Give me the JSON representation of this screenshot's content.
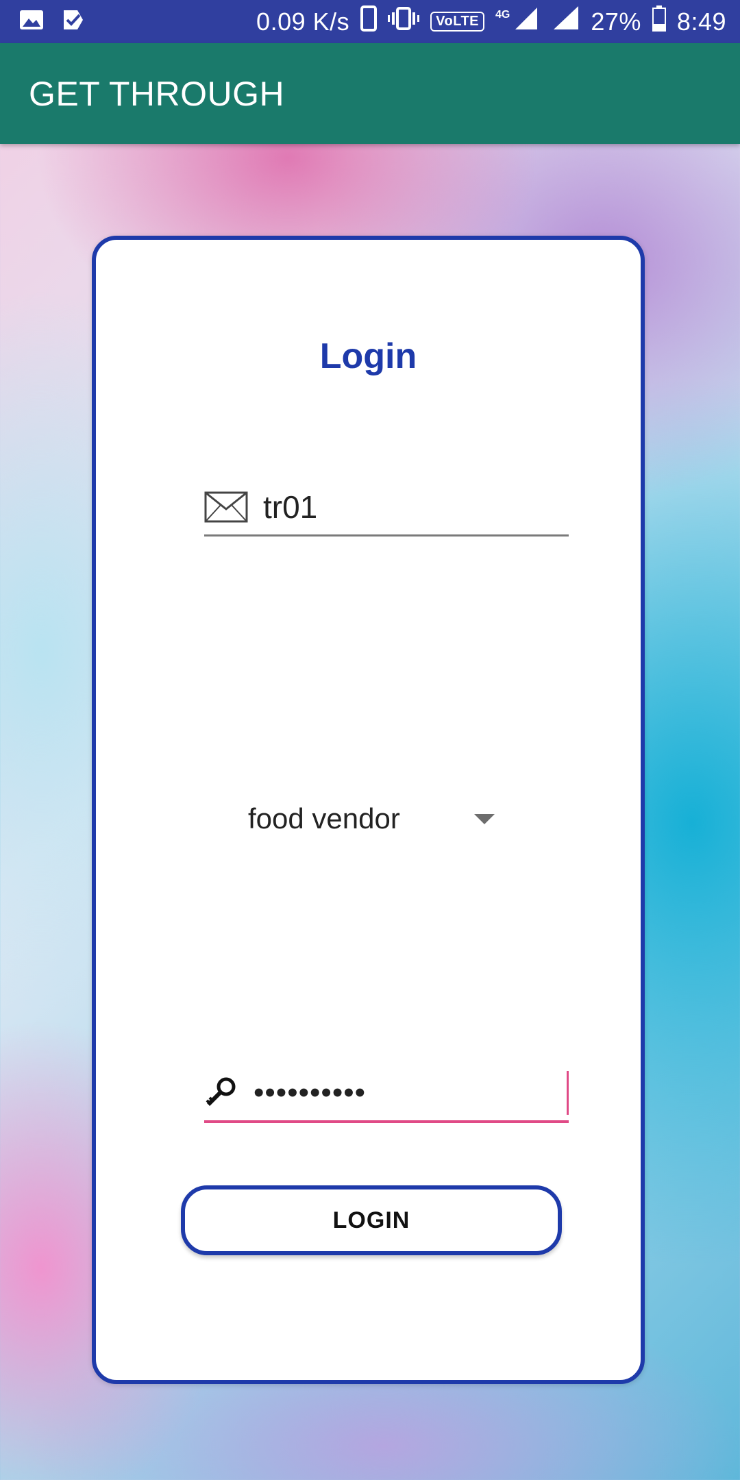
{
  "status_bar": {
    "net_speed": "0.09 K/s",
    "volte": "VoLTE",
    "network": "4G",
    "battery": "27%",
    "time": "8:49",
    "icons": [
      "image-icon",
      "task-check-icon",
      "phone-icon",
      "vibrate-icon",
      "signal-icon",
      "battery-icon"
    ]
  },
  "app_bar": {
    "title": "GET THROUGH"
  },
  "card": {
    "heading": "Login",
    "username": {
      "value": "tr01",
      "icon": "envelope-icon"
    },
    "user_type": {
      "selected": "food vendor"
    },
    "password": {
      "value": "••••••••••",
      "icon": "key-icon"
    },
    "login_button": "LOGIN"
  },
  "colors": {
    "status_bar": "#303f9f",
    "app_bar": "#1a7a6b",
    "accent_blue": "#1e3aaa",
    "focus_pink": "#e04a86"
  }
}
